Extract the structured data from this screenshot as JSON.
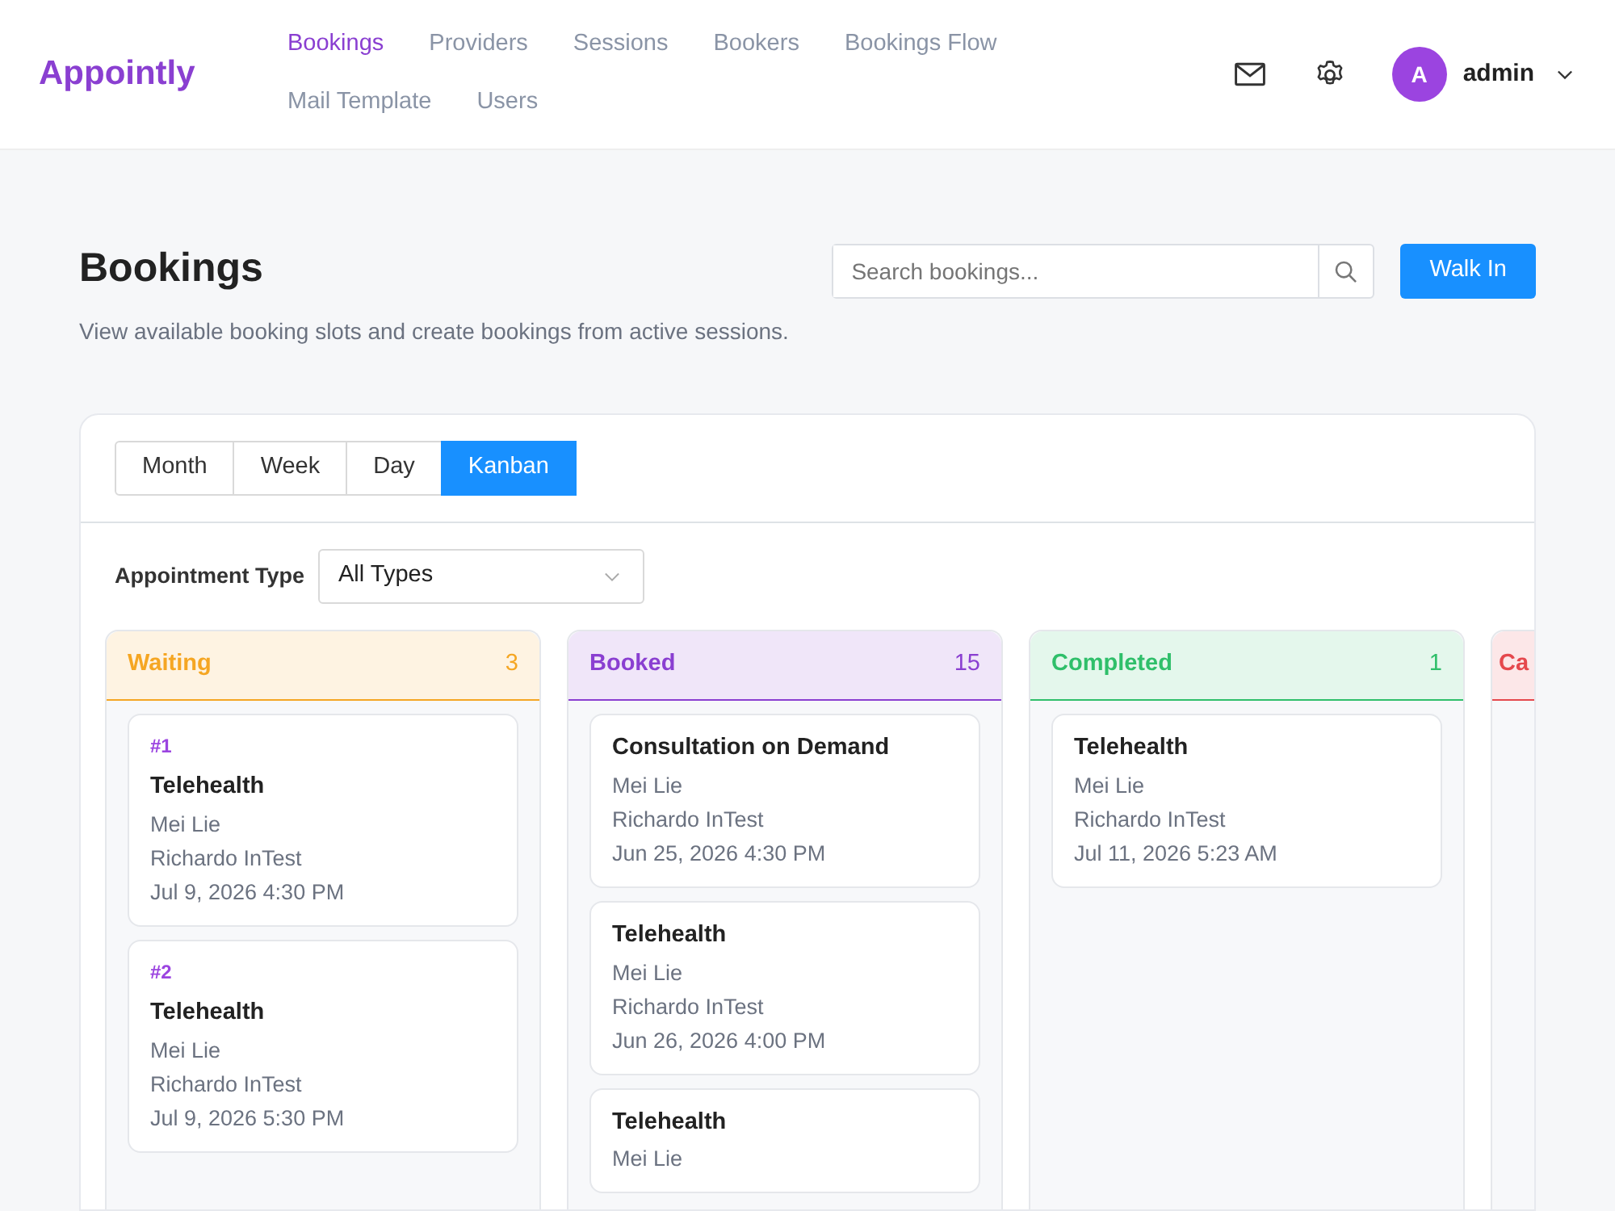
{
  "brand": "Appointly",
  "nav": [
    {
      "label": "Bookings",
      "selected": true
    },
    {
      "label": "Providers",
      "selected": false
    },
    {
      "label": "Sessions",
      "selected": false
    },
    {
      "label": "Bookers",
      "selected": false
    },
    {
      "label": "Bookings Flow",
      "selected": false
    },
    {
      "label": "Mail Template",
      "selected": false
    },
    {
      "label": "Users",
      "selected": false
    }
  ],
  "user": {
    "initial": "A",
    "name": "admin"
  },
  "page": {
    "title": "Bookings",
    "subtitle": "View available booking slots and create bookings from active sessions."
  },
  "search": {
    "placeholder": "Search bookings..."
  },
  "walk_in_button": "Walk In",
  "views": [
    {
      "label": "Month",
      "selected": false
    },
    {
      "label": "Week",
      "selected": false
    },
    {
      "label": "Day",
      "selected": false
    },
    {
      "label": "Kanban",
      "selected": true
    }
  ],
  "filter": {
    "label": "Appointment Type",
    "value": "All Types"
  },
  "columns": [
    {
      "title": "Waiting",
      "count": "3",
      "color": "#f5a623",
      "cards": [
        {
          "number": "#1",
          "title": "Telehealth",
          "booker": "Mei Lie",
          "provider": "Richardo InTest",
          "time": "Jul 9, 2026 4:30 PM"
        },
        {
          "number": "#2",
          "title": "Telehealth",
          "booker": "Mei Lie",
          "provider": "Richardo InTest",
          "time": "Jul 9, 2026 5:30 PM"
        }
      ]
    },
    {
      "title": "Booked",
      "count": "15",
      "color": "#8a3fd1",
      "cards": [
        {
          "title": "Consultation on Demand",
          "booker": "Mei Lie",
          "provider": "Richardo InTest",
          "time": "Jun 25, 2026 4:30 PM"
        },
        {
          "title": "Telehealth",
          "booker": "Mei Lie",
          "provider": "Richardo InTest",
          "time": "Jun 26, 2026 4:00 PM"
        },
        {
          "title": "Telehealth",
          "booker": "Mei Lie"
        }
      ]
    },
    {
      "title": "Completed",
      "count": "1",
      "color": "#2fbf6a",
      "cards": [
        {
          "title": "Telehealth",
          "booker": "Mei Lie",
          "provider": "Richardo InTest",
          "time": "Jul 11, 2026 5:23 AM"
        }
      ]
    },
    {
      "title": "Ca",
      "color": "#e5484d"
    }
  ]
}
